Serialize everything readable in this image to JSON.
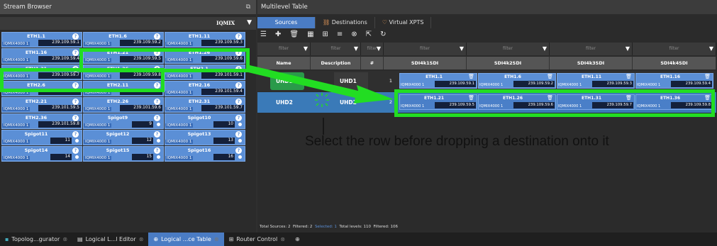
{
  "stream_browser": {
    "title": "Stream Browser",
    "filter_label": "IQMIX",
    "cells": [
      {
        "name": "ETH1.1",
        "device": "IQMIX4000 1",
        "value": "239.109.59.1"
      },
      {
        "name": "ETH1.6",
        "device": "IQMIX4000 1",
        "value": "239.109.59.2"
      },
      {
        "name": "ETH1.11",
        "device": "IQMIX4000 1",
        "value": "239.109.59.3"
      },
      {
        "name": "ETH1.16",
        "device": "IQMIX4000 1",
        "value": "239.109.59.4"
      },
      {
        "name": "ETH1.21",
        "device": "IQMIX4000 1",
        "value": "239.109.59.5"
      },
      {
        "name": "ETH1.26",
        "device": "IQMIX4000 1",
        "value": "239.109.59.6"
      },
      {
        "name": "ETH1.31",
        "device": "IQMIX4000 1",
        "value": "239.109.59.7"
      },
      {
        "name": "ETH1.36",
        "device": "IQMIX4000 1",
        "value": "239.109.59.8"
      },
      {
        "name": "ETH2.1",
        "device": "IQMIX4000 1",
        "value": "239.101.59.1"
      },
      {
        "name": "ETH2.6",
        "device": "IQMIX4000 1",
        "value": "239.101.59.2"
      },
      {
        "name": "ETH2.11",
        "device": "IQMIX4000 1",
        "value": "239.101.59.3"
      },
      {
        "name": "ETH2.16",
        "device": "IQMIX4000 1",
        "value": "239.101.59.4"
      },
      {
        "name": "ETH2.21",
        "device": "IQMIX4000 1",
        "value": "239.101.59.5"
      },
      {
        "name": "ETH2.26",
        "device": "IQMIX4000 1",
        "value": "239.101.59.6"
      },
      {
        "name": "ETH2.31",
        "device": "IQMIX4000 1",
        "value": "239.101.59.7"
      },
      {
        "name": "ETH2.36",
        "device": "IQMIX4000 1",
        "value": "239.101.59.8"
      },
      {
        "name": "Spigot9",
        "device": "IQMIX4000 1",
        "value": "9"
      },
      {
        "name": "Spigot10",
        "device": "IQMIX4000 1",
        "value": "10"
      },
      {
        "name": "Spigot11",
        "device": "IQMIX4000 1",
        "value": "11"
      },
      {
        "name": "Spigot12",
        "device": "IQMIX4000 1",
        "value": "12"
      },
      {
        "name": "Spigot13",
        "device": "IQMIX4000 1",
        "value": "13"
      },
      {
        "name": "Spigot14",
        "device": "IQMIX4000 1",
        "value": "14"
      },
      {
        "name": "Spigot15",
        "device": "IQMIX4000 1",
        "value": "15"
      },
      {
        "name": "Spigot16",
        "device": "IQMIX4000 1",
        "value": "16"
      }
    ]
  },
  "multilevel": {
    "title": "Multilevel Table",
    "tabs": [
      "Sources",
      "Destinations",
      "Virtual XPTS"
    ],
    "filter_placeholder": "filter",
    "headers": [
      "Name",
      "Description",
      "#",
      "SDI4k1SDI",
      "SDI4k2SDI",
      "SDI4k3SDI",
      "SDI4k4SDI"
    ],
    "rows": [
      {
        "name": "UHD1",
        "description": "UHD1",
        "num": "1",
        "levels": [
          {
            "name": "ETH1.1",
            "device": "IQMIX4000 1",
            "value": "239.109.59.1"
          },
          {
            "name": "ETH1.6",
            "device": "IQMIX4000 1",
            "value": "239.109.59.2"
          },
          {
            "name": "ETH1.11",
            "device": "IQMIX4000 1",
            "value": "239.109.59.3"
          },
          {
            "name": "ETH1.16",
            "device": "IQMIX4000 1",
            "value": "239.109.59.4"
          }
        ]
      },
      {
        "name": "UHD2",
        "description": "UHD2",
        "num": "2",
        "levels": [
          {
            "name": "ETH1.21",
            "device": "IQMIX4000 1",
            "value": "239.109.59.5"
          },
          {
            "name": "ETH1.26",
            "device": "IQMIX4000 1",
            "value": "239.109.59.6"
          },
          {
            "name": "ETH1.31",
            "device": "IQMIX4000 1",
            "value": "239.109.59.7"
          },
          {
            "name": "ETH1.36",
            "device": "IQMIX4000 1",
            "value": "239.109.59.8"
          }
        ]
      }
    ],
    "status": {
      "total_sources": "Total Sources: 2",
      "filtered": "Filtered: 2",
      "selected": "Selected: 1",
      "total_levels": "Total levels: 110",
      "filtered_levels": "Filtered: 106"
    }
  },
  "taskbar": [
    "Topolog...gurator",
    "Logical L...l Editor",
    "Logical ...ce Table",
    "Router Control"
  ],
  "callout": "Select the row before dropping a destination onto it",
  "colors": {
    "accent": "#4a7cc4",
    "highlight": "#22dd22",
    "cell": "#5b8fd6",
    "row_selected": "#2a9a4a"
  }
}
